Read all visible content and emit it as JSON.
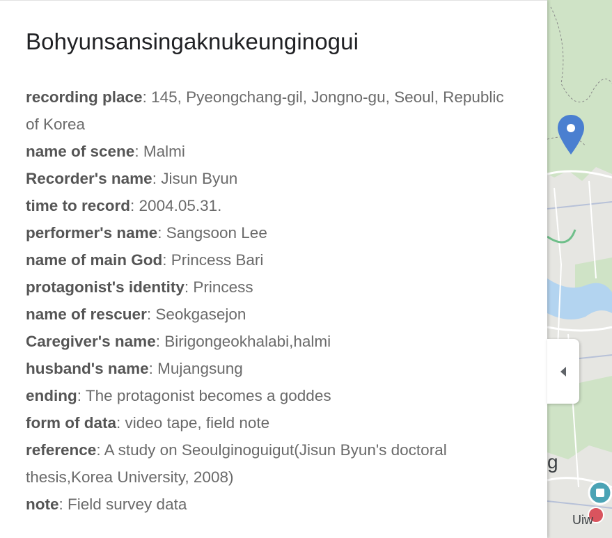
{
  "place": {
    "title": "Bohyunsansingaknukeunginogui"
  },
  "fields": [
    {
      "label": "recording place",
      "value": "145, Pyeongchang-gil, Jongno-gu, Seoul, Republic of Korea"
    },
    {
      "label": "name of scene",
      "value": "Malmi"
    },
    {
      "label": "Recorder's name",
      "value": "Jisun Byun"
    },
    {
      "label": "time to record",
      "value": "2004.05.31."
    },
    {
      "label": "performer's name",
      "value": "Sangsoon Lee"
    },
    {
      "label": "name of main God",
      "value": "Princess Bari"
    },
    {
      "label": "protagonist's identity",
      "value": "Princess"
    },
    {
      "label": "name of rescuer",
      "value": "Seokgasejon"
    },
    {
      "label": "Caregiver's name",
      "value": "Birigongeokhalabi,halmi"
    },
    {
      "label": "husband's name",
      "value": "Mujangsung"
    },
    {
      "label": "ending",
      "value": "The protagonist becomes a goddes"
    },
    {
      "label": "form of data",
      "value": "video tape, field note"
    },
    {
      "label": "reference",
      "value": "A study on Seoulginoguigut(Jisun Byun's doctoral thesis,Korea University, 2008)"
    },
    {
      "label": "note",
      "value": "Field survey data"
    }
  ],
  "separator": ": ",
  "map": {
    "label_partial": "g",
    "label_bottom": "Uiw"
  },
  "colors": {
    "pin": "#4a7fd0",
    "park": "#cfe3c6",
    "water": "#b3d4f0",
    "teal_marker": "#4aa3b5",
    "red_marker": "#d9545e"
  },
  "icons": {
    "collapse": "chevron-left-icon",
    "pin": "map-pin-icon"
  }
}
